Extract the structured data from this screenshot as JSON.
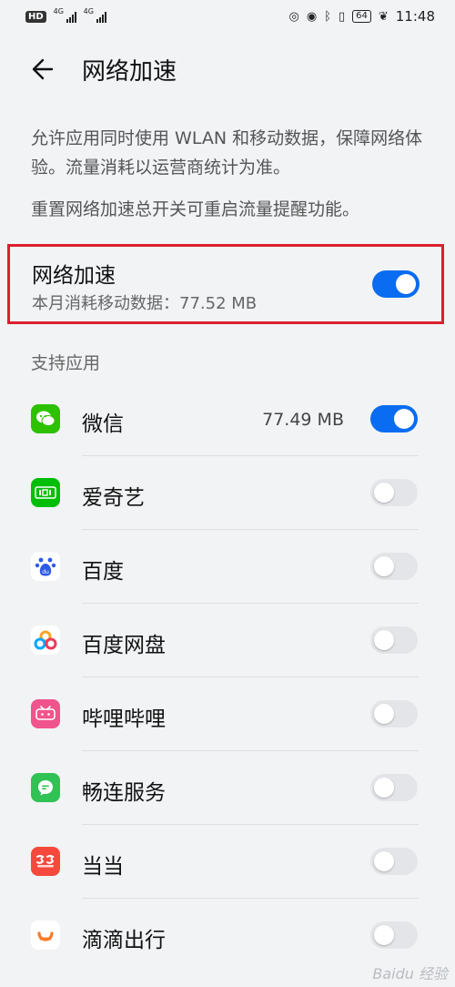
{
  "status_bar": {
    "hd": "HD",
    "sim1_tag": "4G",
    "sim2_tag": "4G",
    "battery": "64",
    "time": "11:48"
  },
  "header": {
    "title": "网络加速"
  },
  "description": {
    "line1": "允许应用同时使用 WLAN 和移动数据，保障网络体验。流量消耗以运营商统计为准。",
    "line2": "重置网络加速总开关可重启流量提醒功能。"
  },
  "master": {
    "title": "网络加速",
    "usage": "本月消耗移动数据：77.52 MB",
    "enabled": true
  },
  "section": {
    "title": "支持应用"
  },
  "apps": [
    {
      "name": "微信",
      "usage": "77.49 MB",
      "enabled": true,
      "icon": "wechat-icon",
      "color": "#2dc100"
    },
    {
      "name": "爱奇艺",
      "usage": "",
      "enabled": false,
      "icon": "iqiyi-icon",
      "color": "#00be06"
    },
    {
      "name": "百度",
      "usage": "",
      "enabled": false,
      "icon": "baidu-icon",
      "color": "#2e5ae6"
    },
    {
      "name": "百度网盘",
      "usage": "",
      "enabled": false,
      "icon": "baidu-netdisk-icon",
      "color": "#06a7ff"
    },
    {
      "name": "哔哩哔哩",
      "usage": "",
      "enabled": false,
      "icon": "bilibili-icon",
      "color": "#f0548c"
    },
    {
      "name": "畅连服务",
      "usage": "",
      "enabled": false,
      "icon": "meetime-icon",
      "color": "#30c254"
    },
    {
      "name": "当当",
      "usage": "",
      "enabled": false,
      "icon": "dangdang-icon",
      "color": "#f5493d"
    },
    {
      "name": "滴滴出行",
      "usage": "",
      "enabled": false,
      "icon": "didi-icon",
      "color": "#fa7a27"
    }
  ],
  "watermark": "Baidu 经验"
}
